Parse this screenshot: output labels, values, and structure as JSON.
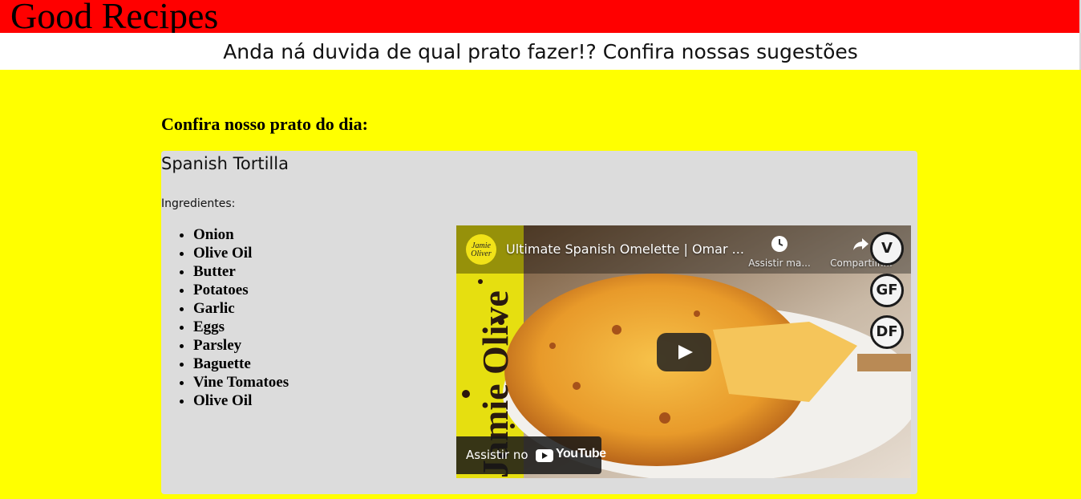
{
  "header": {
    "brand": "Good Recipes",
    "tagline": "Anda ná duvida de qual prato fazer!? Confira nossas sugestões"
  },
  "main": {
    "heading": "Confira nosso prato do dia:",
    "dish": {
      "name": "Spanish Tortilla",
      "ingredients_label": "Ingredientes:",
      "ingredients": [
        "Onion",
        "Olive Oil",
        "Butter",
        "Potatoes",
        "Garlic",
        "Eggs",
        "Parsley",
        "Baguette",
        "Vine Tomatoes",
        "Olive Oil"
      ]
    },
    "video": {
      "title": "Ultimate Spanish Omelette | Omar ...",
      "channel_logo": "Jamie Oliver",
      "spine_text": "Jamie Olive",
      "watch_later_label": "Assistir ma...",
      "share_label": "Compartilh...",
      "watch_on_label": "Assistir no",
      "youtube_word": "YouTube",
      "diet_badges": [
        "V",
        "GF",
        "DF"
      ]
    }
  },
  "colors": {
    "header_bg": "#ff0000",
    "page_bg": "#ffff00",
    "card_bg": "#dcdcdc"
  }
}
